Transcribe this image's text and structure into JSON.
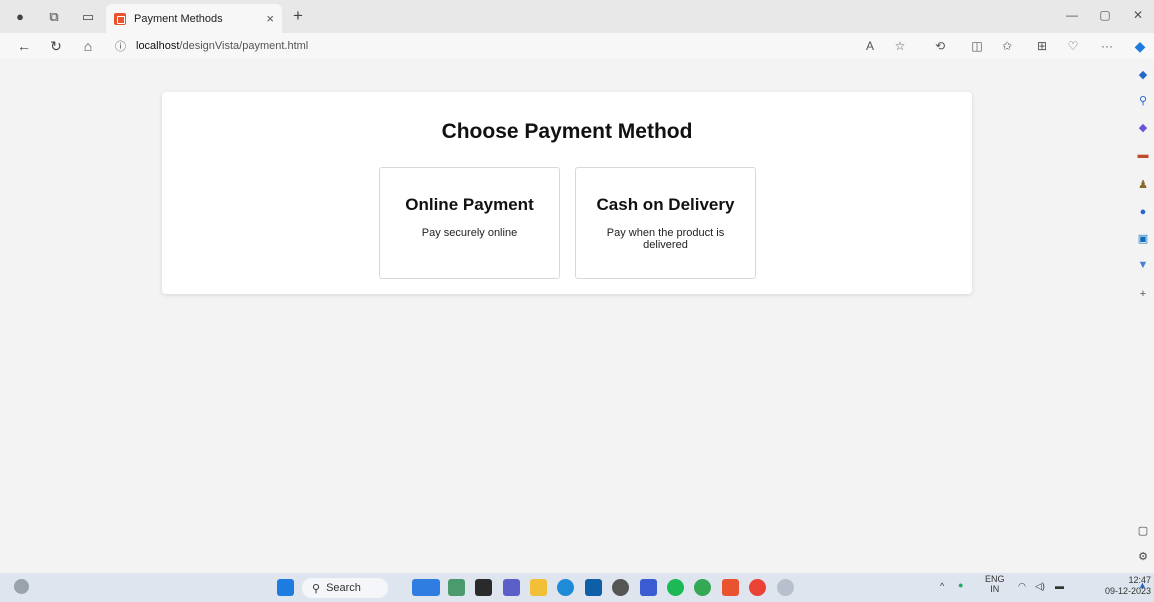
{
  "browser": {
    "tab_title": "Payment Methods",
    "tab_close": "×",
    "new_tab": "+",
    "url_host": "localhost",
    "url_path": "/designVista/payment.html",
    "min": "—",
    "restore": "▢",
    "close": "✕"
  },
  "page": {
    "heading": "Choose Payment Method",
    "options": [
      {
        "title": "Online Payment",
        "desc": "Pay securely online"
      },
      {
        "title": "Cash on Delivery",
        "desc": "Pay when the product is delivered"
      }
    ]
  },
  "taskbar": {
    "search_label": "Search",
    "lang": "ENG",
    "region": "IN",
    "time": "12:47",
    "date": "09-12-2023"
  },
  "colors": {
    "accent_edge": "#0c59a4",
    "card_bg": "#ffffff",
    "page_bg": "#f3f3f3"
  }
}
